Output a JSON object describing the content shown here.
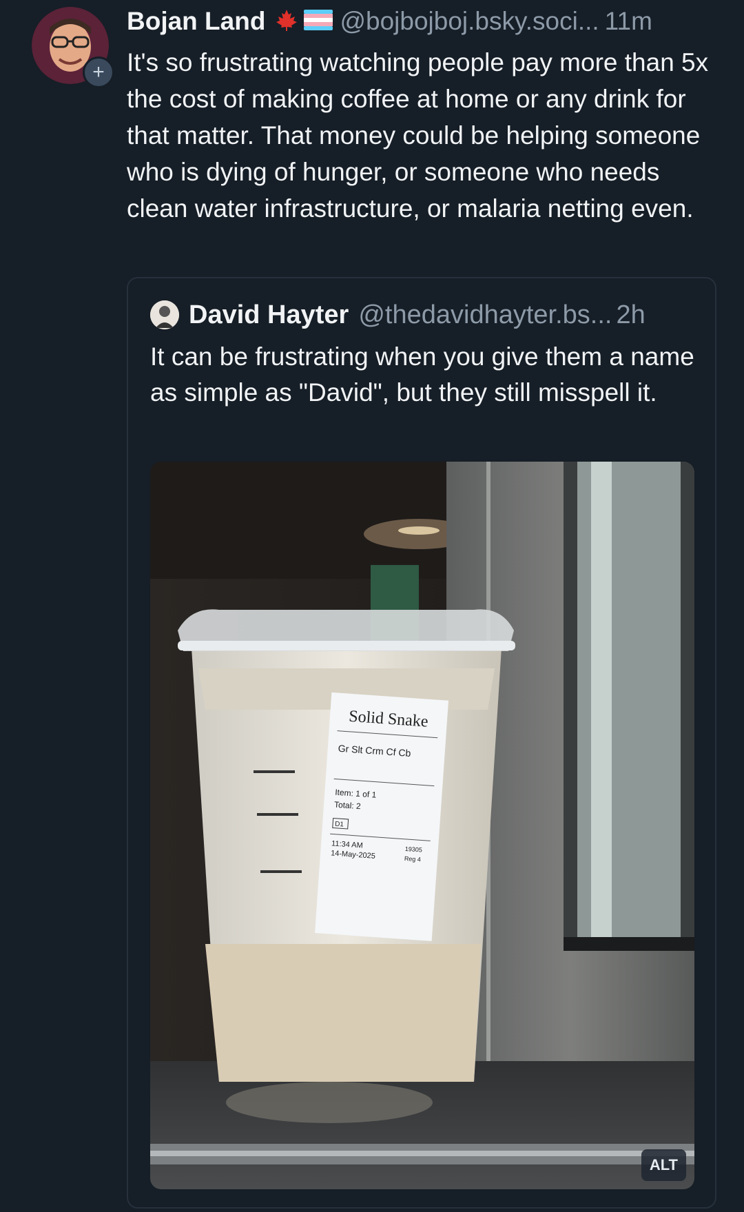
{
  "post": {
    "author_name": "Bojan Land",
    "author_flags": [
      "maple-leaf-icon",
      "trans-flag-icon"
    ],
    "handle": "@bojbojboj.bsky.soci...",
    "time": "11m",
    "text": "It's so frustrating watching people pay more than 5x the cost of making coffee at home or any drink for that matter. That money could be helping someone who is dying of hunger, or someone who needs clean water infrastructure, or malaria netting even.",
    "follow_label": "+"
  },
  "quote": {
    "author_name": "David Hayter",
    "handle": "@thedavidhayter.bs...",
    "time": "2h",
    "text": "It can be frustrating when you give them a name as simple as \"David\", but they still misspell it.",
    "alt_label": "ALT",
    "image": {
      "label_name": "Solid Snake",
      "label_item": "Gr Slt Crm Cf Cb",
      "label_count": "Item: 1 of 1",
      "label_total": "Total: 2",
      "label_code": "D1",
      "label_time": "11:34 AM",
      "label_date": "14-May-2025",
      "label_store": "19305",
      "label_reg": "Reg 4"
    }
  },
  "colors": {
    "background": "#161e27",
    "text": "#f1f3f5",
    "muted": "#8d9aa8",
    "card_border": "#26313d"
  }
}
